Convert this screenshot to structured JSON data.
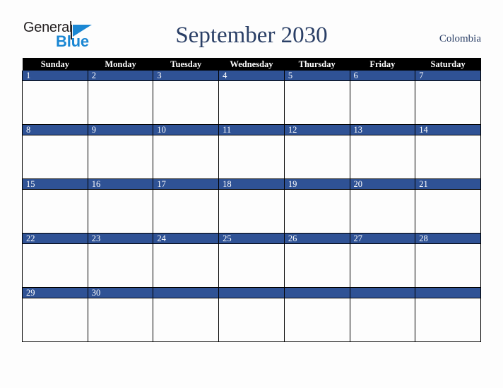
{
  "brand": {
    "name_part1": "General",
    "name_part2": "Blue",
    "triangle_color": "#1b87d3",
    "text_color": "#231f20"
  },
  "header": {
    "title": "September 2030",
    "region": "Colombia",
    "title_color": "#2a3f66"
  },
  "calendar": {
    "month": "September",
    "year": "2030",
    "accent_color": "#2f5295",
    "header_bg": "#000000",
    "weekdays": [
      "Sunday",
      "Monday",
      "Tuesday",
      "Wednesday",
      "Thursday",
      "Friday",
      "Saturday"
    ],
    "weeks": [
      [
        "1",
        "2",
        "3",
        "4",
        "5",
        "6",
        "7"
      ],
      [
        "8",
        "9",
        "10",
        "11",
        "12",
        "13",
        "14"
      ],
      [
        "15",
        "16",
        "17",
        "18",
        "19",
        "20",
        "21"
      ],
      [
        "22",
        "23",
        "24",
        "25",
        "26",
        "27",
        "28"
      ],
      [
        "29",
        "30",
        "",
        "",
        "",
        "",
        ""
      ]
    ]
  }
}
